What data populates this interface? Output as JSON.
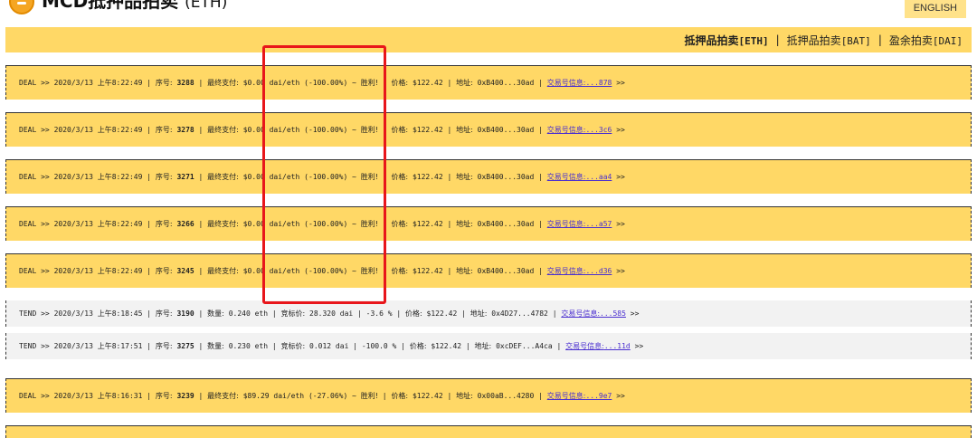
{
  "header": {
    "title": "MCD抵押品拍卖",
    "title_suffix": "(ETH)",
    "language_button": "ENGLISH"
  },
  "nav": {
    "items": [
      {
        "label": "抵押品拍卖",
        "tag": "[ETH]",
        "active": true
      },
      {
        "label": "抵押品拍卖",
        "tag": "[BAT]",
        "active": false
      },
      {
        "label": "盈余拍卖",
        "tag": "[DAI]",
        "active": false
      }
    ],
    "separator": "|"
  },
  "labels": {
    "seq": "序号:",
    "final_pay": "最终支付:",
    "price": "价格:",
    "address": "地址:",
    "tx_info": "交易号信息:",
    "amount": "数量:",
    "bid_price": "竞标价:",
    "win": "胜利!",
    "arrow": ">>"
  },
  "events": [
    {
      "type": "DEAL",
      "time": "2020/3/13 上午8:22:49",
      "seq": "3288",
      "pay": "$0.00 dai/eth",
      "pct": "(-100.00%)",
      "price": "$122.42",
      "address": "0xB400...30ad",
      "tx": "...878"
    },
    {
      "type": "DEAL",
      "time": "2020/3/13 上午8:22:49",
      "seq": "3278",
      "pay": "$0.00 dai/eth",
      "pct": "(-100.00%)",
      "price": "$122.42",
      "address": "0xB400...30ad",
      "tx": "...3c6"
    },
    {
      "type": "DEAL",
      "time": "2020/3/13 上午8:22:49",
      "seq": "3271",
      "pay": "$0.00 dai/eth",
      "pct": "(-100.00%)",
      "price": "$122.42",
      "address": "0xB400...30ad",
      "tx": "...aa4"
    },
    {
      "type": "DEAL",
      "time": "2020/3/13 上午8:22:49",
      "seq": "3266",
      "pay": "$0.00 dai/eth",
      "pct": "(-100.00%)",
      "price": "$122.42",
      "address": "0xB400...30ad",
      "tx": "...a57"
    },
    {
      "type": "DEAL",
      "time": "2020/3/13 上午8:22:49",
      "seq": "3245",
      "pay": "$0.00 dai/eth",
      "pct": "(-100.00%)",
      "price": "$122.42",
      "address": "0xB400...30ad",
      "tx": "...d36"
    },
    {
      "type": "TEND",
      "time": "2020/3/13 上午8:18:45",
      "seq": "3190",
      "amount": "0.240 eth",
      "bid": "28.320 dai",
      "pct": "-3.6 %",
      "price": "$122.42",
      "address": "0x4D27...4782",
      "tx": "...585"
    },
    {
      "type": "TEND",
      "time": "2020/3/13 上午8:17:51",
      "seq": "3275",
      "amount": "0.230 eth",
      "bid": "0.012 dai",
      "pct": "-100.0 %",
      "price": "$122.42",
      "address": "0xcDEF...A4ca",
      "tx": "...11d"
    },
    {
      "type": "DEAL",
      "time": "2020/3/13 上午8:16:31",
      "seq": "3239",
      "pay": "$89.29 dai/eth",
      "pct": "(-27.06%)",
      "price": "$122.42",
      "address": "0x00aB...4280",
      "tx": "...9e7"
    }
  ]
}
